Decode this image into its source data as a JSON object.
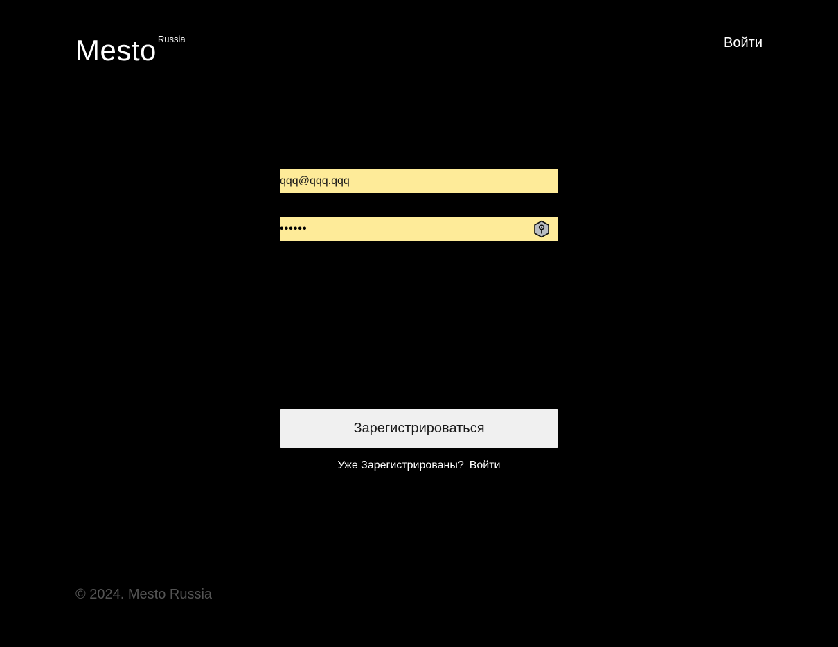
{
  "header": {
    "logo_text": "Mesto",
    "logo_superscript": "Russia",
    "login_link": "Войти"
  },
  "form": {
    "email_value": "qqq@qqq.qqq",
    "password_mask": "••••••",
    "password_icon": "key-icon",
    "submit_label": "Зарегистрироваться",
    "hint_text": "Уже Зарегистрированы?",
    "hint_link": "Войти",
    "field_background": "#feeb99"
  },
  "footer": {
    "copyright": "© 2024. Mesto Russia"
  },
  "colors": {
    "background": "#000000",
    "button_background": "#f0f0f0",
    "footer_text": "#545454"
  }
}
